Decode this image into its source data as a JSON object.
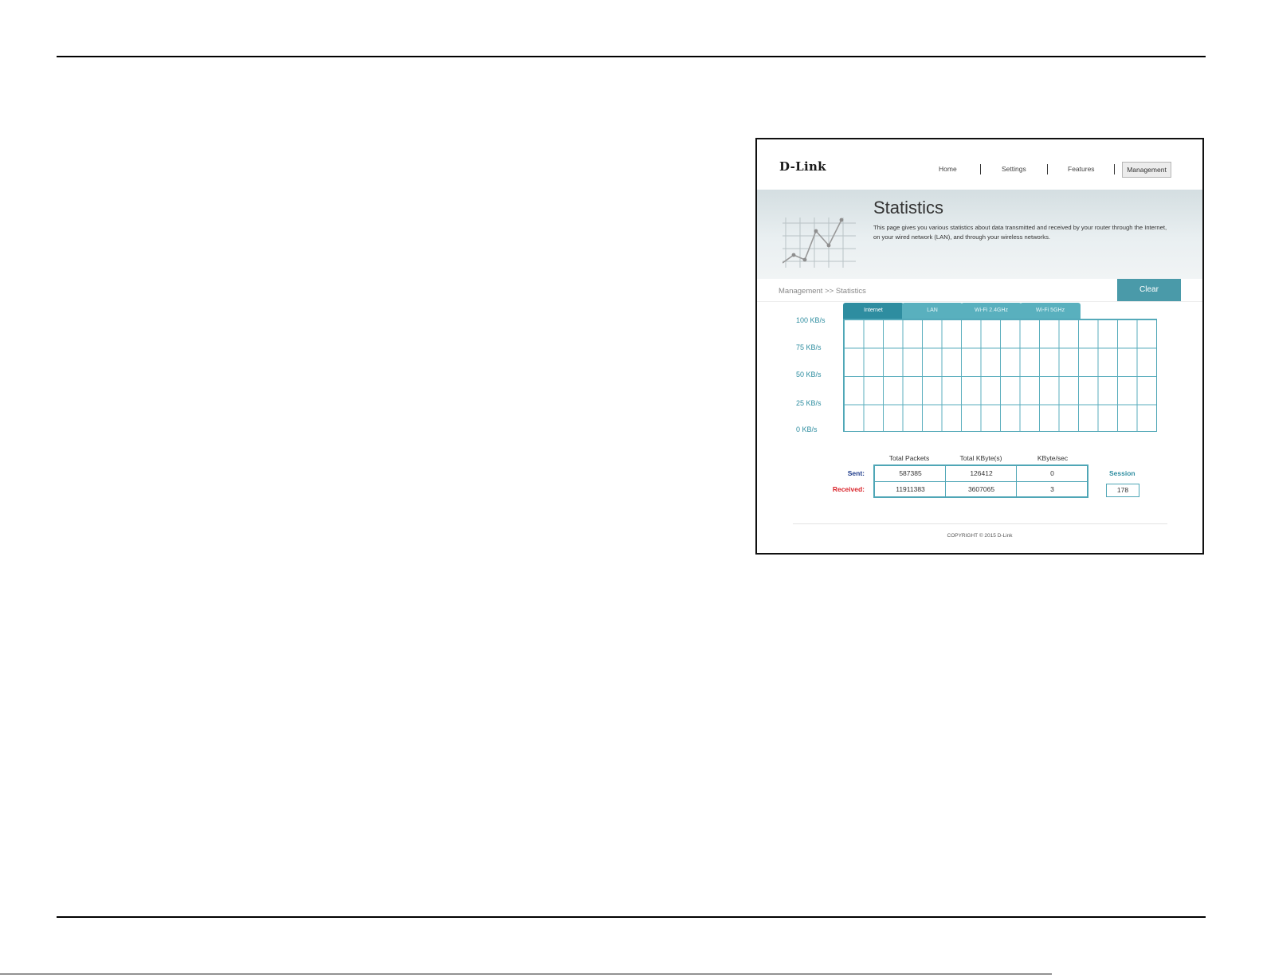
{
  "router": {
    "brand": "D-Link",
    "nav": [
      "Home",
      "Settings",
      "Features",
      "Management"
    ],
    "active_nav": "Management",
    "page_title": "Statistics",
    "description": "This page gives you various statistics about data transmitted and received by your router through the Internet, on your wired network (LAN), and through your wireless networks.",
    "breadcrumb": "Management >> Statistics",
    "clear_label": "Clear",
    "tabs": [
      "Internet",
      "LAN",
      "Wi-Fi 2.4GHz",
      "Wi-Fi 5GHz"
    ],
    "active_tab": "Internet",
    "y_labels": [
      "100 KB/s",
      "75 KB/s",
      "50 KB/s",
      "25 KB/s",
      "0 KB/s"
    ],
    "table": {
      "headers": [
        "Total Packets",
        "Total KByte(s)",
        "KByte/sec"
      ],
      "sent_label": "Sent:",
      "received_label": "Received:",
      "sent": [
        "587385",
        "126412",
        "0"
      ],
      "received": [
        "11911383",
        "3607065",
        "3"
      ]
    },
    "session_label": "Session",
    "session_value": "178",
    "copyright": "COPYRIGHT © 2015 D-Link"
  },
  "colors": {
    "accent": "#4a9aa9",
    "sent": "#1e3b8a",
    "received": "#d9232a"
  }
}
